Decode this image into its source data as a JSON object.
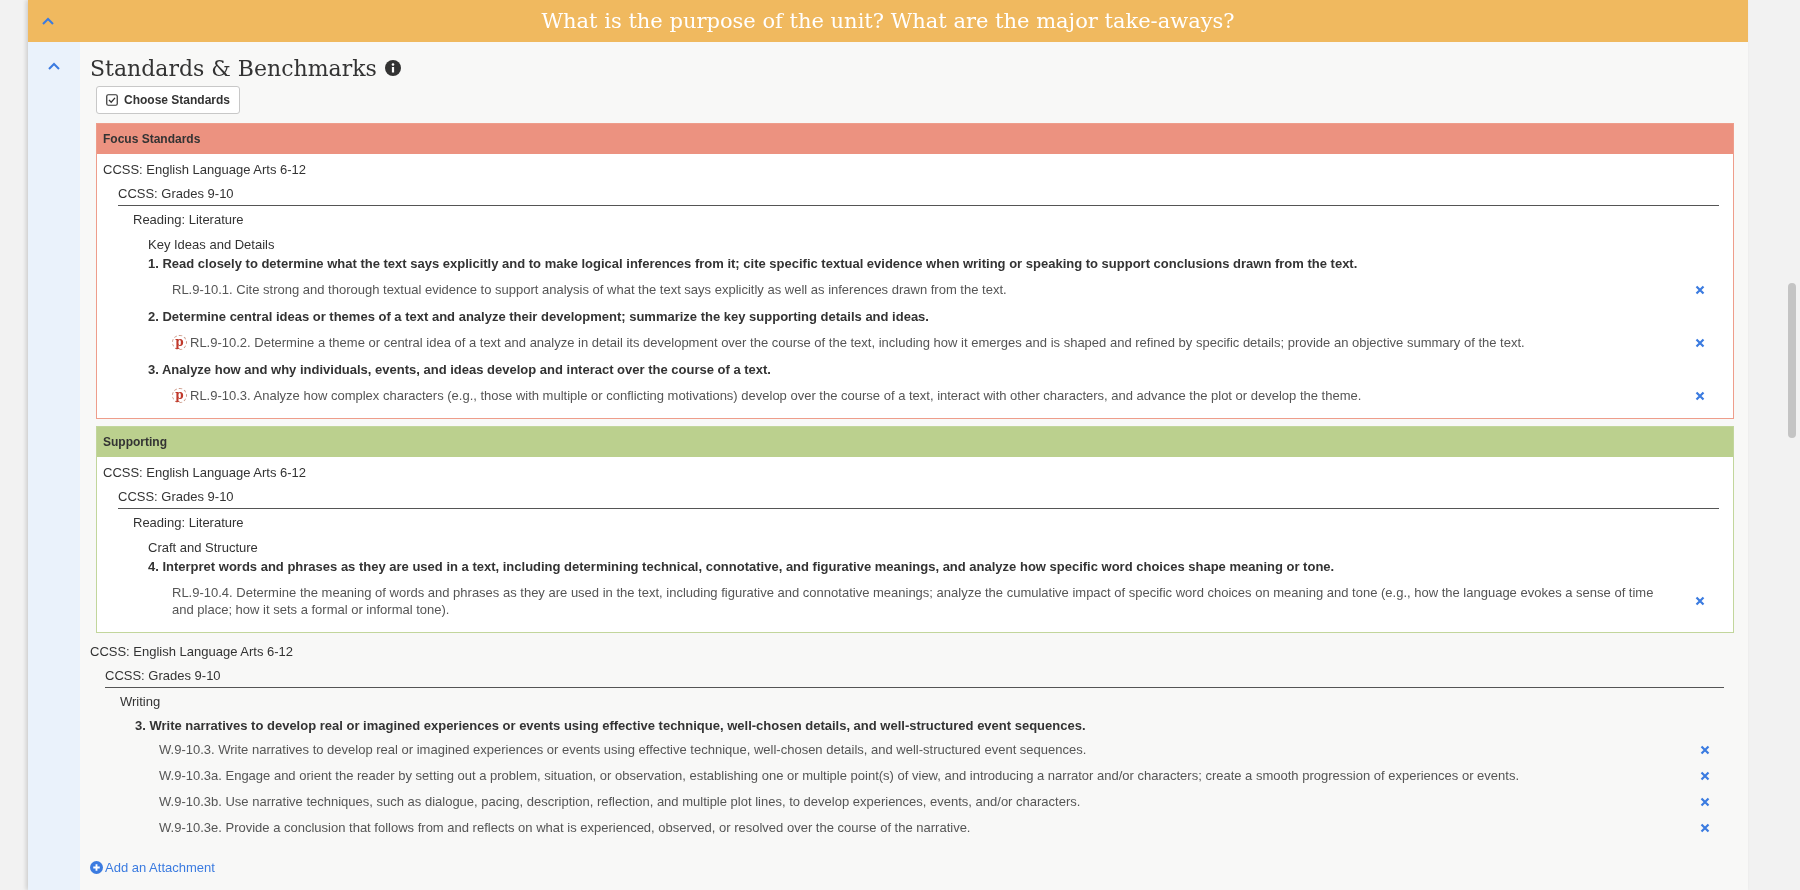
{
  "banner": {
    "title": "What is the purpose of the unit? What are the major take-aways?",
    "expanded": true
  },
  "section": {
    "title": "Standards & Benchmarks",
    "expanded": true
  },
  "choose_button": "Choose Standards",
  "groups": [
    {
      "kind": "focus",
      "title": "Focus Standards",
      "framework": "CCSS: English Language Arts 6-12",
      "grade": "CCSS: Grades 9-10",
      "domain": "Reading: Literature",
      "cluster": "Key Ideas and Details",
      "standards": [
        {
          "text": "1. Read closely to determine what the text says explicitly and to make logical inferences from it; cite specific textual evidence when writing or speaking to support conclusions drawn from the text.",
          "items": [
            {
              "text": "RL.9-10.1. Cite strong and thorough textual evidence to support analysis of what the text says explicitly as well as inferences drawn from the text."
            }
          ]
        },
        {
          "text": "2. Determine central ideas or themes of a text and analyze their development; summarize the key supporting details and ideas.",
          "items": [
            {
              "badge": "p",
              "text": "RL.9-10.2. Determine a theme or central idea of a text and analyze in detail its development over the course of the text, including how it emerges and is shaped and refined by specific details; provide an objective summary of the text."
            }
          ]
        },
        {
          "text": "3. Analyze how and why individuals, events, and ideas develop and interact over the course of a text.",
          "items": [
            {
              "badge": "p",
              "text": "RL.9-10.3. Analyze how complex characters (e.g., those with multiple or conflicting motivations) develop over the course of a text, interact with other characters, and advance the plot or develop the theme."
            }
          ]
        }
      ]
    },
    {
      "kind": "supporting",
      "title": "Supporting",
      "framework": "CCSS: English Language Arts 6-12",
      "grade": "CCSS: Grades 9-10",
      "domain": "Reading: Literature",
      "cluster": "Craft and Structure",
      "standards": [
        {
          "text": "4. Interpret words and phrases as they are used in a text, including determining technical, connotative, and figurative meanings, and analyze how specific word choices shape meaning or tone.",
          "items": [
            {
              "text": "RL.9-10.4. Determine the meaning of words and phrases as they are used in the text, including figurative and connotative meanings; analyze the cumulative impact of specific word choices on meaning and tone (e.g., how the language evokes a sense of time and place; how it sets a formal or informal tone)."
            }
          ]
        }
      ]
    },
    {
      "kind": "plain",
      "framework": "CCSS: English Language Arts 6-12",
      "grade": "CCSS: Grades 9-10",
      "domain": "Writing",
      "standards": [
        {
          "text": "3. Write narratives to develop real or imagined experiences or events using effective technique, well-chosen details, and well-structured event sequences.",
          "items": [
            {
              "text": "W.9-10.3. Write narratives to develop real or imagined experiences or events using effective technique, well-chosen details, and well-structured event sequences."
            },
            {
              "text": "W.9-10.3a. Engage and orient the reader by setting out a problem, situation, or observation, establishing one or multiple point(s) of view, and introducing a narrator and/or characters; create a smooth progression of experiences or events."
            },
            {
              "text": "W.9-10.3b. Use narrative techniques, such as dialogue, pacing, description, reflection, and multiple plot lines, to develop experiences, events, and/or characters."
            },
            {
              "text": "W.9-10.3e. Provide a conclusion that follows from and reflects on what is experienced, observed, or resolved over the course of the narrative."
            }
          ]
        }
      ]
    }
  ],
  "add_attachment": "Add an Attachment"
}
